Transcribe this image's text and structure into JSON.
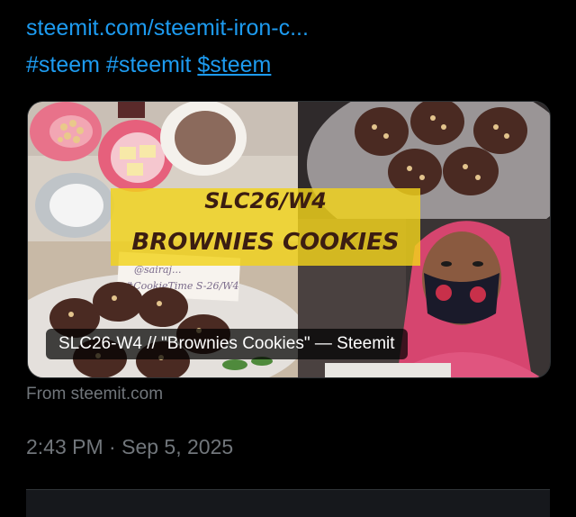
{
  "tweet": {
    "link_text": "steemit.com/steemit-iron-c...",
    "hashtags": [
      "#steem",
      "#steemit"
    ],
    "cashtag": "$steem"
  },
  "card": {
    "image_title_line1": "SLC26/W4",
    "image_title_line2": "BROWNIES COOKIES",
    "handwritten_note_line1": "@sairaj...",
    "handwritten_note_line2": "#CookieTime S-26/W4",
    "caption": "SLC26-W4 // \"Brownies Cookies\" — Steemit",
    "source": "From steemit.com"
  },
  "meta": {
    "time": "2:43 PM",
    "separator": "·",
    "date": "Sep 5, 2025"
  },
  "colors": {
    "link": "#1d9bf0",
    "muted": "#71767b",
    "background": "#000000",
    "title_banner": "#f2d31b"
  }
}
